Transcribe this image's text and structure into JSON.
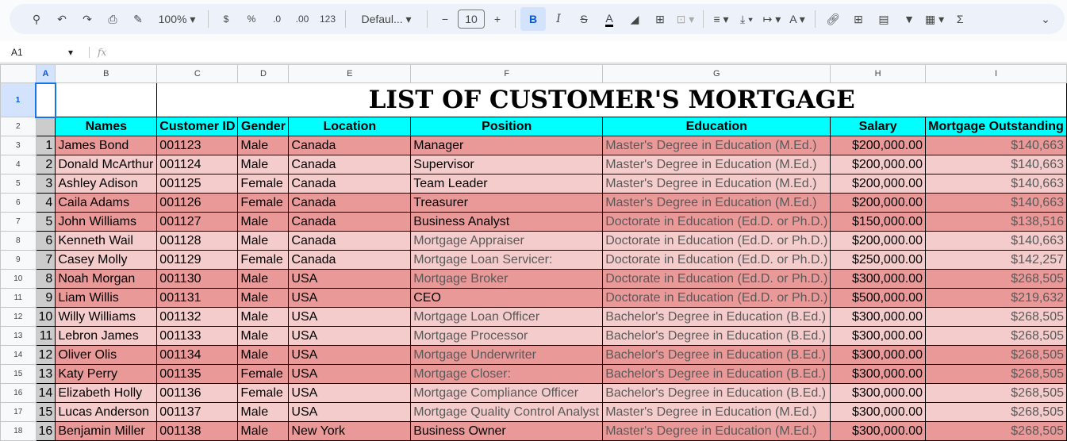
{
  "toolbar": {
    "zoom": "100%",
    "currency": "$",
    "percent": "%",
    "dec_less": ".0",
    "dec_more": ".00",
    "format_123": "123",
    "font": "Defaul...",
    "font_size": "10",
    "bold": "B",
    "italic": "I",
    "sum": "Σ"
  },
  "formula_bar": {
    "cell_ref": "A1",
    "fx": "fx"
  },
  "columns": [
    "A",
    "B",
    "C",
    "D",
    "E",
    "F",
    "G",
    "H",
    "I"
  ],
  "title": "LIST OF CUSTOMER'S MORTGAGE",
  "headers": [
    "Names",
    "Customer ID",
    "Gender",
    "Location",
    "Position",
    "Education",
    "Salary",
    "Mortgage Outstanding"
  ],
  "rows": [
    [
      "1",
      "James Bond",
      "001123",
      "Male",
      "Canada",
      "Manager",
      "Master's Degree in Education (M.Ed.)",
      "$200,000.00",
      "$140,663"
    ],
    [
      "2",
      "Donald McArthur",
      "001124",
      "Male",
      "Canada",
      "Supervisor",
      "Master's Degree in Education (M.Ed.)",
      "$200,000.00",
      "$140,663"
    ],
    [
      "3",
      "Ashley Adison",
      "001125",
      "Female",
      "Canada",
      "Team Leader",
      "Master's Degree in Education (M.Ed.)",
      "$200,000.00",
      "$140,663"
    ],
    [
      "4",
      "Caila Adams",
      "001126",
      "Female",
      "Canada",
      "Treasurer",
      "Master's Degree in Education (M.Ed.)",
      "$200,000.00",
      "$140,663"
    ],
    [
      "5",
      "John Williams",
      "001127",
      "Male",
      "Canada",
      "Business Analyst",
      "Doctorate in Education (Ed.D. or Ph.D.)",
      "$150,000.00",
      "$138,516"
    ],
    [
      "6",
      "Kenneth Wail",
      "001128",
      "Male",
      "Canada",
      "Mortgage Appraiser",
      "Doctorate in Education (Ed.D. or Ph.D.)",
      "$200,000.00",
      "$140,663"
    ],
    [
      "7",
      "Casey Molly",
      "001129",
      "Female",
      "Canada",
      "Mortgage Loan Servicer:",
      "Doctorate in Education (Ed.D. or Ph.D.)",
      "$250,000.00",
      "$142,257"
    ],
    [
      "8",
      "Noah Morgan",
      "001130",
      "Male",
      "USA",
      "Mortgage Broker",
      "Doctorate in Education (Ed.D. or Ph.D.)",
      "$300,000.00",
      "$268,505"
    ],
    [
      "9",
      "Liam Willis",
      "001131",
      "Male",
      "USA",
      "CEO",
      "Doctorate in Education (Ed.D. or Ph.D.)",
      "$500,000.00",
      "$219,632"
    ],
    [
      "10",
      "Willy Williams",
      "001132",
      "Male",
      "USA",
      "Mortgage Loan Officer",
      "Bachelor's Degree in Education (B.Ed.)",
      "$300,000.00",
      "$268,505"
    ],
    [
      "11",
      "Lebron James",
      "001133",
      "Male",
      "USA",
      "Mortgage Processor",
      "Bachelor's Degree in Education (B.Ed.)",
      "$300,000.00",
      "$268,505"
    ],
    [
      "12",
      "Oliver Olis",
      "001134",
      "Male",
      "USA",
      "Mortgage Underwriter",
      "Bachelor's Degree in Education (B.Ed.)",
      "$300,000.00",
      "$268,505"
    ],
    [
      "13",
      "Katy Perry",
      "001135",
      "Female",
      "USA",
      "Mortgage Closer:",
      "Bachelor's Degree in Education (B.Ed.)",
      "$300,000.00",
      "$268,505"
    ],
    [
      "14",
      "Elizabeth Holly",
      "001136",
      "Female",
      "USA",
      "Mortgage Compliance Officer",
      "Bachelor's Degree in Education (B.Ed.)",
      "$300,000.00",
      "$268,505"
    ],
    [
      "15",
      "Lucas Anderson",
      "001137",
      "Male",
      "USA",
      "Mortgage Quality Control Analyst",
      "Master's Degree in Education (M.Ed.)",
      "$300,000.00",
      "$268,505"
    ],
    [
      "16",
      "Benjamin Miller",
      "001138",
      "Male",
      "New York",
      "Business Owner",
      "Master's Degree in Education (M.Ed.)",
      "$300,000.00",
      "$268,505"
    ]
  ],
  "colors": {
    "dark_row": "#ea9999",
    "light_row": "#f4cccc",
    "header": "#00ffff"
  }
}
